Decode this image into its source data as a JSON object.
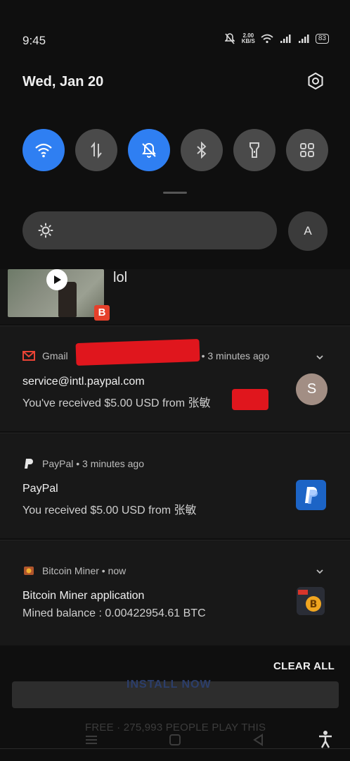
{
  "status_bar": {
    "time": "9:45",
    "speed_value": "2.00",
    "speed_unit": "KB/S",
    "battery": "83"
  },
  "header": {
    "date": "Wed, Jan 20"
  },
  "quick_toggles": [
    {
      "name": "wifi",
      "on": true
    },
    {
      "name": "mobile-data",
      "on": false
    },
    {
      "name": "do-not-disturb",
      "on": true
    },
    {
      "name": "bluetooth",
      "on": false
    },
    {
      "name": "flashlight",
      "on": false
    },
    {
      "name": "more",
      "on": false
    }
  ],
  "brightness": {
    "auto_label": "A"
  },
  "notifications": {
    "video": {
      "title": "lol",
      "badge": "B"
    },
    "gmail": {
      "app": "Gmail",
      "time": "• 3 minutes ago",
      "title": "service@intl.paypal.com",
      "body": "You've received $5.00 USD from 张敏",
      "body_tail": "..",
      "avatar_letter": "S"
    },
    "paypal": {
      "app_line": "PayPal • 3 minutes ago",
      "title": "PayPal",
      "body": "You received $5.00 USD from 张敏"
    },
    "bitcoin": {
      "app_line": "Bitcoin Miner • now",
      "title": "Bitcoin Miner application",
      "body": "Mined balance : 0.00422954.61 BTC"
    }
  },
  "actions": {
    "clear_all": "CLEAR ALL"
  },
  "background": {
    "install_button": "INSTALL NOW",
    "free_text": "FREE · 275,993 PEOPLE PLAY THIS"
  },
  "colors": {
    "accent_blue": "#2f7ff2",
    "gmail_red": "#ea4335",
    "paypal_blue": "#1c64c6",
    "redaction": "#e0161d"
  }
}
